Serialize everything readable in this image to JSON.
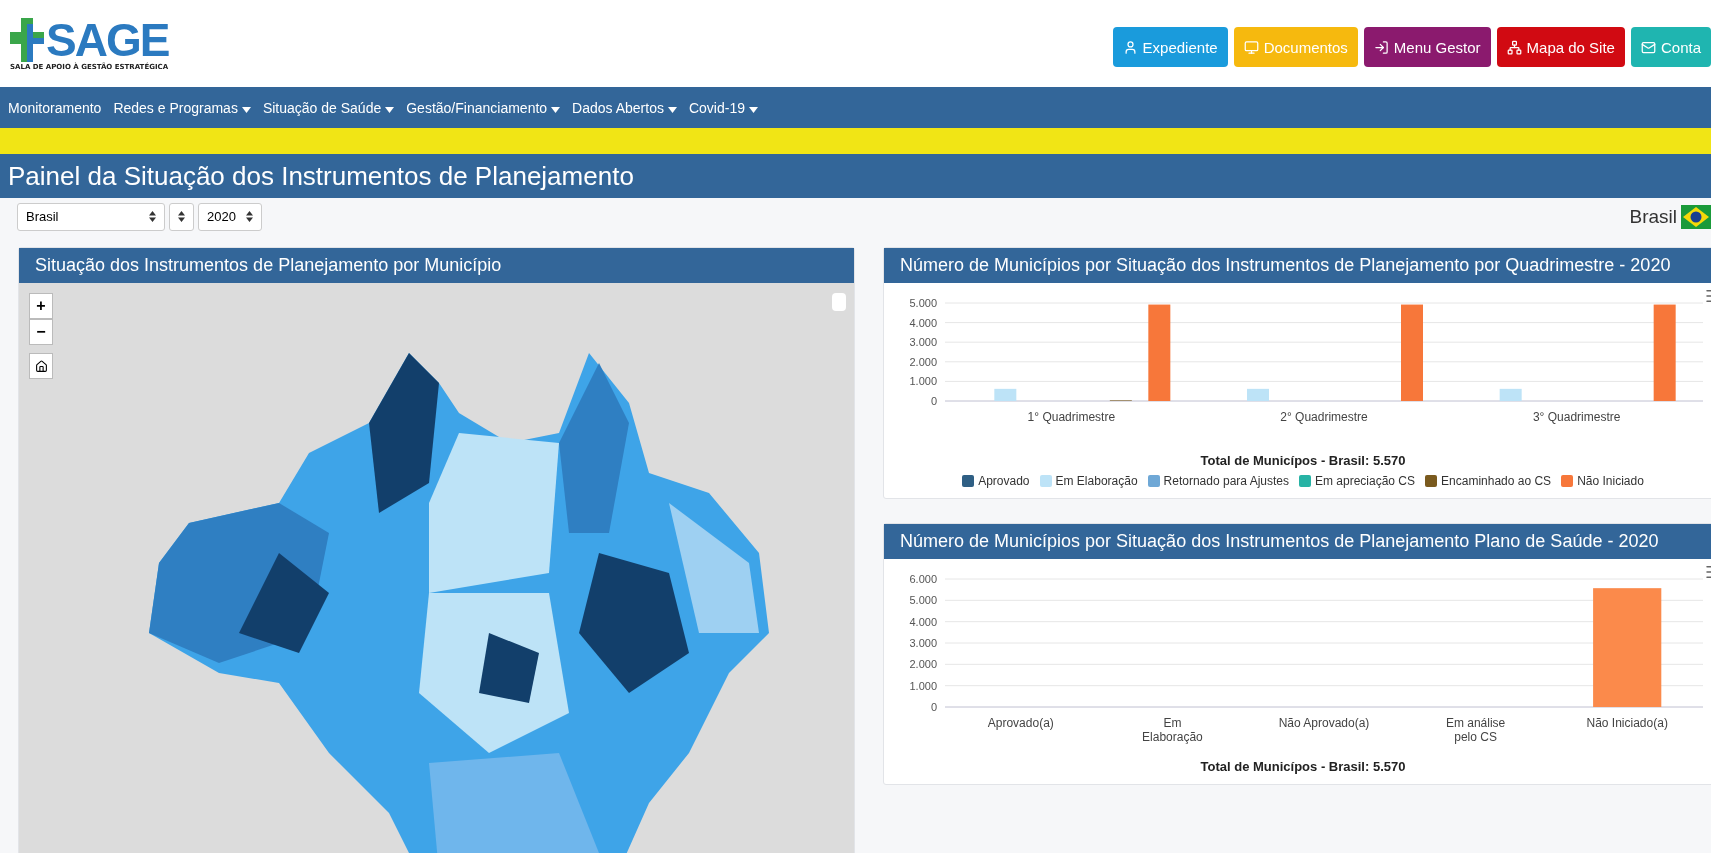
{
  "logo": {
    "name": "SAGE",
    "subtitle": "SALA DE APOIO À GESTÃO ESTRATÉGICA"
  },
  "header_buttons": [
    {
      "label": "Expediente",
      "kind": "user",
      "color": "#1a9bdc"
    },
    {
      "label": "Documentos",
      "kind": "monitor",
      "color": "#f6b90e"
    },
    {
      "label": "Menu Gestor",
      "kind": "login",
      "color": "#8b1a6e"
    },
    {
      "label": "Mapa do Site",
      "kind": "sitemap",
      "color": "#d10a12"
    },
    {
      "label": "Conta",
      "kind": "mail",
      "color": "#1fb5b0"
    }
  ],
  "nav": [
    {
      "label": "Monitoramento",
      "dropdown": false
    },
    {
      "label": "Redes e Programas",
      "dropdown": true
    },
    {
      "label": "Situação de Saúde",
      "dropdown": true
    },
    {
      "label": "Gestão/Financiamento",
      "dropdown": true
    },
    {
      "label": "Dados Abertos",
      "dropdown": true
    },
    {
      "label": "Covid-19",
      "dropdown": true
    }
  ],
  "page_title": "Painel da Situação dos Instrumentos de Planejamento",
  "filters": {
    "location": "Brasil",
    "year": "2020"
  },
  "region_label": "Brasil",
  "map_panel": {
    "title": "Situação dos Instrumentos de Planejamento por Município",
    "zoom_in": "+",
    "zoom_out": "−"
  },
  "chart_panels": [
    {
      "title": "Número de Municípios por Situação dos Instrumentos de Planejamento por Quadrimestre - 2020",
      "chart_data": {
        "type": "bar",
        "xlabel": "Total de Municípos - Brasil: 5.570",
        "categories": [
          "1° Quadrimestre",
          "2° Quadrimestre",
          "3° Quadrimestre"
        ],
        "ylim": [
          0,
          5000
        ],
        "grid": true,
        "yticks": [
          {
            "value": 0,
            "label": "0"
          },
          {
            "value": 1000,
            "label": "1.000"
          },
          {
            "value": 2000,
            "label": "2.000"
          },
          {
            "value": 3000,
            "label": "3.000"
          },
          {
            "value": 4000,
            "label": "4.000"
          },
          {
            "value": 5000,
            "label": "5.000"
          }
        ],
        "series": [
          {
            "name": "Aprovado",
            "color": "#2f5f84",
            "values": [
              0,
              0,
              0
            ]
          },
          {
            "name": "Em Elaboração",
            "color": "#bde3f7",
            "values": [
              620,
              620,
              620
            ]
          },
          {
            "name": "Retornado para Ajustes",
            "color": "#6fa8d6",
            "values": [
              0,
              0,
              0
            ]
          },
          {
            "name": "Em apreciação CS",
            "color": "#27b3a5",
            "values": [
              0,
              0,
              0
            ]
          },
          {
            "name": "Encaminhado ao CS",
            "color": "#7a5a1e",
            "values": [
              30,
              0,
              0
            ]
          },
          {
            "name": "Não Iniciado",
            "color": "#f7773a",
            "values": [
              4920,
              4920,
              4920
            ]
          }
        ]
      }
    },
    {
      "title": "Número de Municípios por Situação dos Instrumentos de Planejamento Plano de Saúde - 2020",
      "chart_data": {
        "type": "bar",
        "xlabel": "Total de Municípos - Brasil: 5.570",
        "categories": [
          "Aprovado(a)",
          "Em Elaboração",
          "Não Aprovado(a)",
          "Em análise pelo CS",
          "Não Iniciado(a)"
        ],
        "ylim": [
          0,
          6000
        ],
        "yticks": [
          {
            "value": 0,
            "label": "0"
          },
          {
            "value": 1000,
            "label": "1.000"
          },
          {
            "value": 2000,
            "label": "2.000"
          },
          {
            "value": 3000,
            "label": "3.000"
          },
          {
            "value": 4000,
            "label": "4.000"
          },
          {
            "value": 5000,
            "label": "5.000"
          },
          {
            "value": 6000,
            "label": "6.000"
          }
        ],
        "grid": true,
        "series": [
          {
            "color": "#fb8a4b",
            "values": [
              0,
              0,
              0,
              0,
              5570
            ]
          }
        ]
      }
    }
  ]
}
